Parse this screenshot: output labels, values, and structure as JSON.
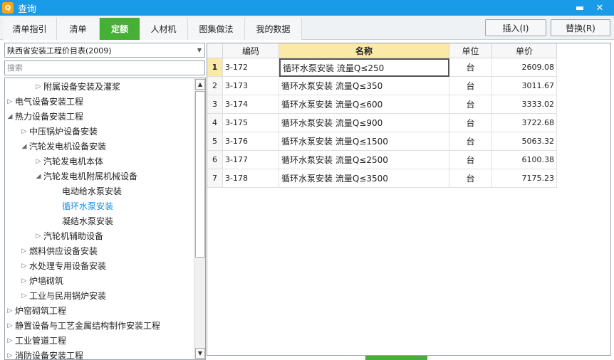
{
  "window": {
    "title": "查询",
    "icon_glyph": "Q",
    "minimize": "▬",
    "close": "✕"
  },
  "tabs": [
    "清单指引",
    "清单",
    "定额",
    "人材机",
    "图集做法",
    "我的数据"
  ],
  "active_tab": 2,
  "actions": {
    "insert": "插入(I)",
    "replace": "替换(R)"
  },
  "library": {
    "selected": "陕西省安装工程价目表(2009)"
  },
  "search": {
    "placeholder": "搜索"
  },
  "tree": [
    {
      "label": "附属设备安装及灌浆",
      "level": 2,
      "toggle": "▷"
    },
    {
      "label": "电气设备安装工程",
      "level": 0,
      "toggle": "▷"
    },
    {
      "label": "热力设备安装工程",
      "level": 0,
      "toggle": "◢"
    },
    {
      "label": "中压锅炉设备安装",
      "level": 1,
      "toggle": "▷"
    },
    {
      "label": "汽轮发电机设备安装",
      "level": 1,
      "toggle": "◢"
    },
    {
      "label": "汽轮发电机本体",
      "level": 2,
      "toggle": "▷"
    },
    {
      "label": "汽轮发电机附属机械设备",
      "level": 2,
      "toggle": "◢"
    },
    {
      "label": "电动给水泵安装",
      "level": 3,
      "toggle": ""
    },
    {
      "label": "循环水泵安装",
      "level": 3,
      "toggle": "",
      "selected": true
    },
    {
      "label": "凝结水泵安装",
      "level": 3,
      "toggle": ""
    },
    {
      "label": "汽轮机辅助设备",
      "level": 2,
      "toggle": "▷"
    },
    {
      "label": "燃料供应设备安装",
      "level": 1,
      "toggle": "▷"
    },
    {
      "label": "水处理专用设备安装",
      "level": 1,
      "toggle": "▷"
    },
    {
      "label": "炉墙砌筑",
      "level": 1,
      "toggle": "▷"
    },
    {
      "label": "工业与民用锅炉安装",
      "level": 1,
      "toggle": "▷"
    },
    {
      "label": "炉窑砌筑工程",
      "level": 0,
      "toggle": "▷"
    },
    {
      "label": "静置设备与工艺金属结构制作安装工程",
      "level": 0,
      "toggle": "▷"
    },
    {
      "label": "工业管道工程",
      "level": 0,
      "toggle": "▷"
    },
    {
      "label": "消防设备安装工程",
      "level": 0,
      "toggle": "▷"
    }
  ],
  "grid": {
    "headers": {
      "code": "编码",
      "name": "名称",
      "unit": "单位",
      "price": "单价"
    },
    "rows": [
      {
        "no": "1",
        "code": "3-172",
        "name": "循环水泵安装 流量Q≤250",
        "unit": "台",
        "price": "2609.08"
      },
      {
        "no": "2",
        "code": "3-173",
        "name": "循环水泵安装 流量Q≤350",
        "unit": "台",
        "price": "3011.67"
      },
      {
        "no": "3",
        "code": "3-174",
        "name": "循环水泵安装 流量Q≤600",
        "unit": "台",
        "price": "3333.02"
      },
      {
        "no": "4",
        "code": "3-175",
        "name": "循环水泵安装 流量Q≤900",
        "unit": "台",
        "price": "3722.68"
      },
      {
        "no": "5",
        "code": "3-176",
        "name": "循环水泵安装 流量Q≤1500",
        "unit": "台",
        "price": "5063.32"
      },
      {
        "no": "6",
        "code": "3-177",
        "name": "循环水泵安装 流量Q≤2500",
        "unit": "台",
        "price": "6100.38"
      },
      {
        "no": "7",
        "code": "3-178",
        "name": "循环水泵安装 流量Q≤3500",
        "unit": "台",
        "price": "7175.23"
      }
    ]
  },
  "colors": {
    "titlebar": "#1a9be8",
    "active_tab": "#45b035",
    "header_highlight": "#fbe9a8",
    "selected_tree_text": "#1a8be0"
  }
}
